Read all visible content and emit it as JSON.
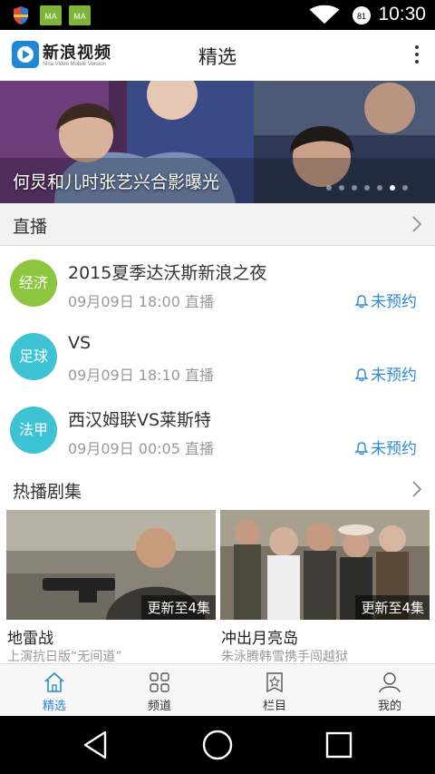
{
  "status_bar": {
    "time": "10:30",
    "battery": "81",
    "icons": [
      "shield-icon",
      "app-notification-icon",
      "app-notification-icon",
      "wifi-icon",
      "battery-icon"
    ]
  },
  "header": {
    "logo_text": "新浪视频",
    "logo_subtext": "Sina Video Mobile Version",
    "title": "精选",
    "menu_icon": "more-vertical-icon"
  },
  "banner": {
    "caption": "何炅和儿时张艺兴合影曝光",
    "slide_count": 7,
    "active_slide": 6
  },
  "live_section": {
    "title": "直播",
    "items": [
      {
        "category": "经济",
        "color": "#8cc63f",
        "title": "2015夏季达沃斯新浪之夜",
        "time": "09月09日 18:00 直播",
        "remind": "未预约"
      },
      {
        "category": "足球",
        "color": "#3ec3d5",
        "title": "VS",
        "time": "09月09日 18:10 直播",
        "remind": "未预约"
      },
      {
        "category": "法甲",
        "color": "#3ec3d5",
        "title": "西汉姆联VS莱斯特",
        "time": "09月09日 00:05 直播",
        "remind": "未预约"
      }
    ]
  },
  "drama_section": {
    "title": "热播剧集",
    "cards": [
      {
        "badge": "更新至4集",
        "title": "地雷战",
        "subtitle": "上演抗日版“无间道”"
      },
      {
        "badge": "更新至4集",
        "title": "冲出月亮岛",
        "subtitle": "朱泳腾韩雪携手闯越狱"
      }
    ]
  },
  "tabs": [
    {
      "label": "精选",
      "icon": "home-icon",
      "active": true
    },
    {
      "label": "频道",
      "icon": "grid-icon",
      "active": false
    },
    {
      "label": "栏目",
      "icon": "star-bookmark-icon",
      "active": false
    },
    {
      "label": "我的",
      "icon": "user-icon",
      "active": false
    }
  ],
  "colors": {
    "accent": "#2d8ad6",
    "economy": "#8cc63f",
    "sports": "#3ec3d5"
  }
}
